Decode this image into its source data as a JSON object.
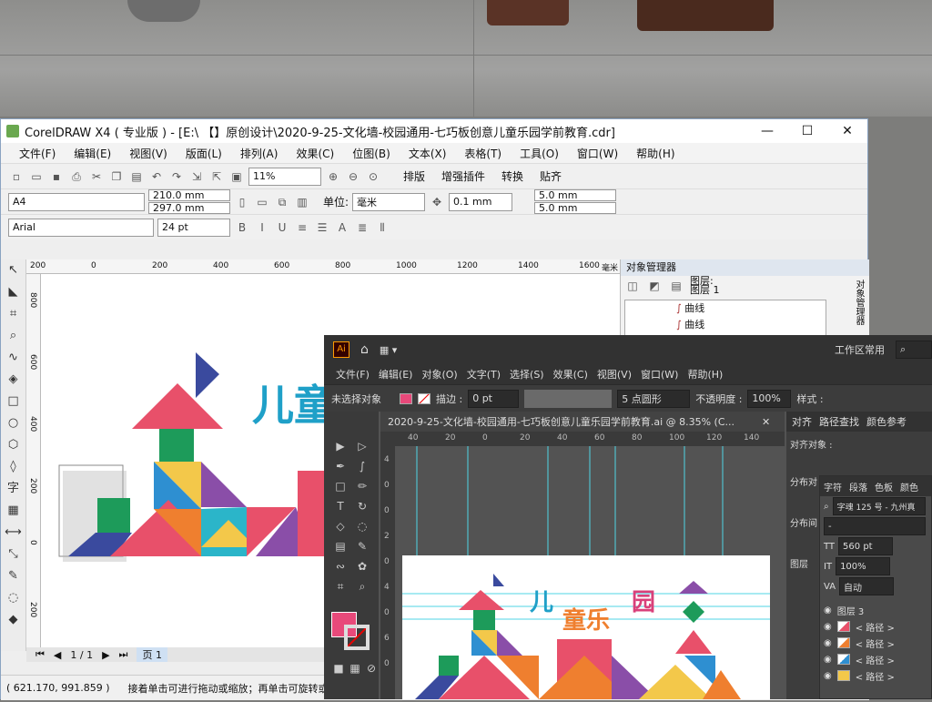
{
  "cdr": {
    "title": "CorelDRAW X4 ( 专业版 ) - [E:\\ 【】原创设计\\2020-9-25-文化墙-校园通用-七巧板创意儿童乐园学前教育.cdr]",
    "menu": [
      "文件(F)",
      "编辑(E)",
      "视图(V)",
      "版面(L)",
      "排列(A)",
      "效果(C)",
      "位图(B)",
      "文本(X)",
      "表格(T)",
      "工具(O)",
      "窗口(W)",
      "帮助(H)"
    ],
    "zoom": "11%",
    "plugins": [
      "排版",
      "增强插件",
      "转换",
      "贴齐"
    ],
    "paper": "A4",
    "width": "210.0 mm",
    "height": "297.0 mm",
    "unit_label": "单位:",
    "unit": "毫米",
    "nudge": "0.1 mm",
    "dup_x": "5.0 mm",
    "dup_y": "5.0 mm",
    "font": "Arial",
    "font_size": "24 pt",
    "ruler_h": [
      "200",
      "0",
      "200",
      "400",
      "600",
      "800",
      "1000",
      "1200",
      "1400",
      "1600"
    ],
    "ruler_unit": "毫米",
    "ruler_v": [
      "800",
      "600",
      "400",
      "200",
      "0",
      "200"
    ],
    "page_info": "1 / 1",
    "page_tab": "页 1",
    "status_coords": "( 621.170, 991.859 )",
    "status_text": "接着单击可进行拖动或缩放；再单击可旋转或倾",
    "objmgr": {
      "title": "对象管理器",
      "layer_label1": "图层:",
      "layer_label2": "图层 1",
      "items": [
        "曲线",
        "曲线"
      ]
    },
    "side_tab": "对象管理器",
    "canvas_text": "儿童"
  },
  "ai": {
    "workspace": "工作区常用",
    "menu": [
      "文件(F)",
      "编辑(E)",
      "对象(O)",
      "文字(T)",
      "选择(S)",
      "效果(C)",
      "视图(V)",
      "窗口(W)",
      "帮助(H)"
    ],
    "no_selection": "未选择对象",
    "stroke_label": "描边 :",
    "stroke_value": "0 pt",
    "brush": "5 点圆形",
    "opacity_label": "不透明度 :",
    "opacity_value": "100%",
    "style_label": "样式 :",
    "doc_tab": "2020-9-25-文化墙-校园通用-七巧板创意儿童乐园学前教育.ai @ 8.35% (C...",
    "ruler_h": [
      "40",
      "20",
      "0",
      "20",
      "40",
      "60",
      "80",
      "100",
      "120",
      "140"
    ],
    "ruler_v": [
      "4",
      "0",
      "0",
      "2",
      "0",
      "4",
      "0",
      "6",
      "0"
    ],
    "panel_tabs": [
      "对齐",
      "路径查找",
      "颜色参考"
    ],
    "align_label": "对齐对象 :",
    "dist_label1": "分布对",
    "dist_label2": "分布间",
    "layers_label": "图层",
    "char_tabs": [
      "字符",
      "段落",
      "色板",
      "颜色"
    ],
    "font": "字魂 125 号 - 九州真",
    "font_style": "-",
    "font_size": "560 pt",
    "scale": "100%",
    "leading": "自动",
    "layer_name": "图层 3",
    "path_items": [
      "< 路径 >",
      "< 路径 >",
      "< 路径 >",
      "< 路径 >"
    ],
    "art_title1": "儿",
    "art_title2": "童乐",
    "art_title3": "园"
  }
}
